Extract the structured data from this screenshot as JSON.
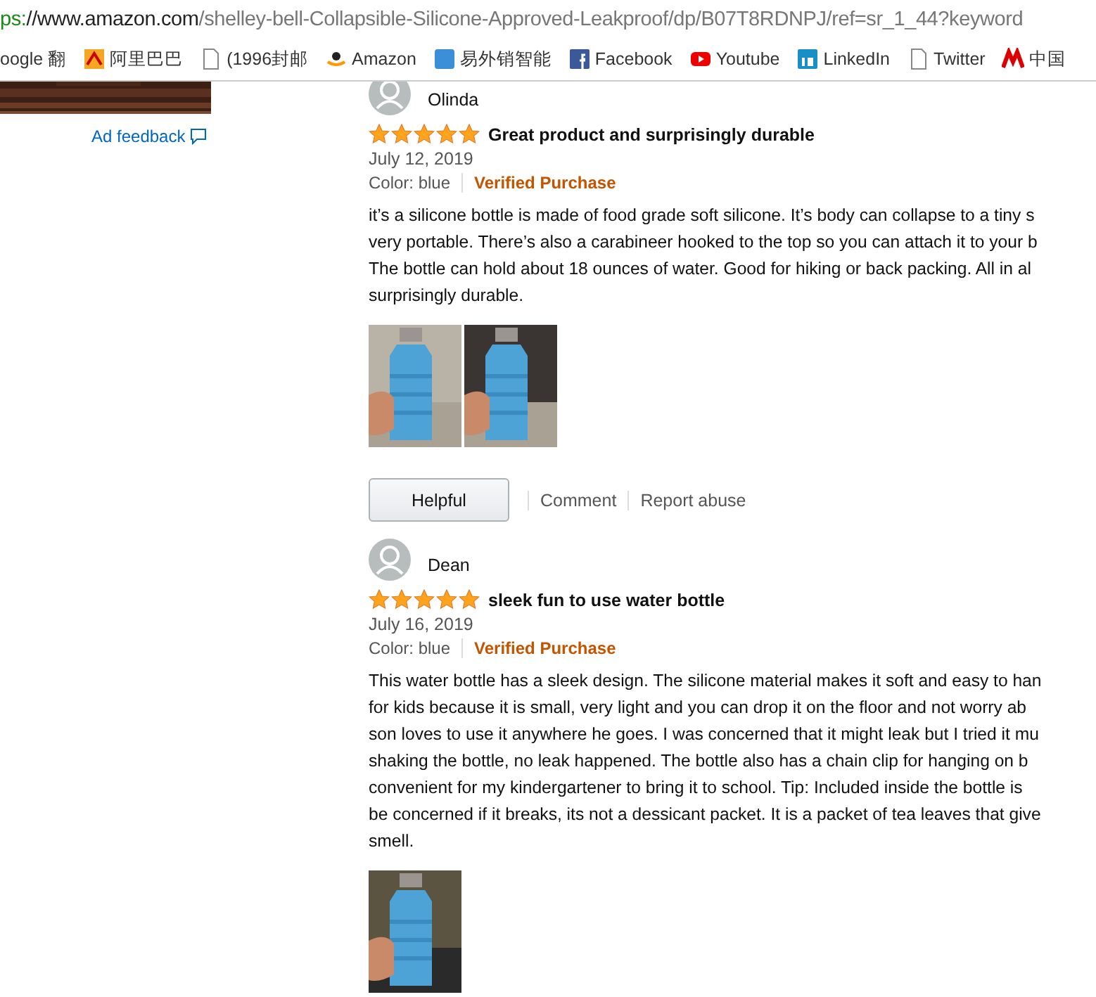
{
  "address_bar": {
    "scheme": "ps:",
    "host": "//www.amazon.com",
    "path": "/shelley-bell-Collapsible-Silicone-Approved-Leakproof/dp/B07T8RDNPJ/ref=sr_1_44?keyword"
  },
  "bookmarks": [
    {
      "label": "oogle 翻",
      "kind": "none"
    },
    {
      "label": "阿里巴巴",
      "kind": "tile"
    },
    {
      "label": "(1996封邮",
      "kind": "page"
    },
    {
      "label": "Amazon",
      "kind": "smile"
    },
    {
      "label": "易外销智能",
      "kind": "blue"
    },
    {
      "label": "Facebook",
      "kind": "navy"
    },
    {
      "label": "Youtube",
      "kind": "play"
    },
    {
      "label": "LinkedIn",
      "kind": "sky"
    },
    {
      "label": "Twitter",
      "kind": "page"
    },
    {
      "label": "中国",
      "kind": "red"
    }
  ],
  "sidebar": {
    "ad": {
      "kind": "picture"
    },
    "ad_feedback": "Ad feedback"
  },
  "reviews": [
    {
      "author": "Olinda",
      "stars": 5,
      "title": "Great product and surprisingly durable",
      "date": "July 12, 2019",
      "variant": "Color: blue",
      "badge": "Verified Purchase",
      "lines": [
        "it’s a silicone bottle is made of food grade soft silicone. It’s body can collapse to a tiny s",
        "very portable. There’s also a carabineer hooked to the top so you can attach it to your b",
        "The bottle can hold about 18 ounces of water. Good for hiking or back packing. All in al",
        "surprisingly durable."
      ],
      "photos": [
        {
          "kind": "picture"
        },
        {
          "kind": "picture"
        }
      ],
      "actions": {
        "helpful": "Helpful",
        "comment": "Comment",
        "report": "Report abuse"
      }
    },
    {
      "author": "Dean",
      "stars": 5,
      "title": "sleek fun to use water bottle",
      "date": "July 16, 2019",
      "variant": "Color: blue",
      "badge": "Verified Purchase",
      "lines": [
        "This water bottle has a sleek design. The silicone material makes it soft and easy to han",
        "for kids because it is small, very light and you can drop it on the floor and not worry ab",
        "son loves to use it anywhere he goes. I was concerned that it might leak but I tried it mu",
        "shaking the bottle, no leak happened. The bottle also has a chain clip for hanging on b",
        "convenient for my kindergartener to bring it to school. Tip: Included inside the bottle is",
        "be concerned if it breaks, its not a dessicant packet. It is a packet of tea leaves that give",
        "smell."
      ],
      "photos": [
        {
          "kind": "picture"
        }
      ]
    }
  ]
}
